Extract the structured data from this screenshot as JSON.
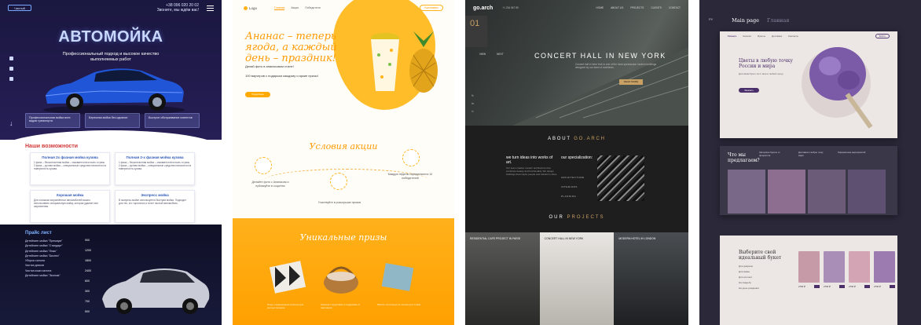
{
  "carwash": {
    "phone": "+38 096 020 20 02",
    "phone_sub": "Звоните, мы ждём вас!",
    "logo": "Чистый",
    "title": "АВТОМОЙКА",
    "subtitle": "Профессиональный подход и высокое качество выполняемых работ",
    "features": [
      "Профессиональная мойка всех видов транспорта",
      "Бережная мойка без царапин",
      "Быстрое обслуживание клиентов"
    ],
    "section_title": "Наши возможности",
    "services": [
      {
        "title": "Полная 2х фазная мойка кузова",
        "text": "1 фаза – бесконтактная мойка – смывается вся пыль и грязь. 2 фаза – ручная мойка – специальные средства наносятся на поверхность кузова."
      },
      {
        "title": "Полная 2-х фазная мойка кузова",
        "text": "1 фаза – бесконтактная мойка – смывается вся пыль и грязь. 2 фаза – ручная мойка – специальные средства наносятся на поверхность кузова."
      },
      {
        "title": "Хорошая мойка",
        "text": "Для слишком загрязнённых автомобилей можно использовать специальную мойку, которая удаляет все загрязнения."
      },
      {
        "title": "Экспресс мойка",
        "text": "В экспресс-мойке используется быстрая мойка. Подходит для тех, кто торопится и хочет чистый автомобиль."
      }
    ],
    "price_title": "Прайс лист",
    "prices": [
      "Детейлинг мойка \"Премиум\"",
      "Детейлинг мойка \"Стандарт\"",
      "Детейлинг мойка \"Люкс\"",
      "Детейлинг мойка \"Бизнес\"",
      "Уборка салона",
      "Чистка дисков",
      "Чистка кожи салона",
      "Детейлинг мойка \"Эконом\""
    ],
    "price_values": [
      "900",
      "1200",
      "1800",
      "2400",
      "600",
      "300",
      "700",
      "500"
    ]
  },
  "pineapple": {
    "logo": "Logo",
    "nav": [
      "Главная",
      "Акция",
      "Победители"
    ],
    "top_button": "Участвовать",
    "headline": "Ананас – теперь ягода, а каждый день – праздник!",
    "sub1": "Делай фото в ананасовом стиле!",
    "sub2": "100 ваучеров с подарком каждому и яркие призы!",
    "cta": "Подробнее",
    "conditions_title": "Условия акции",
    "steps": [
      "Делайте фото с Ананасом и публикуйте в соцсетях",
      "Участвуйте в розыгрыше призов",
      "Каждую неделю определяются 10 победителей"
    ],
    "prizes_title": "Уникальные призы",
    "prize_texts": [
      "Плед с ананасовым принтом для уютных вечеров",
      "Корзина с фруктами и подарками от партнёров",
      "Мягкое полотенце из хлопка для пляжа"
    ]
  },
  "arch": {
    "logo": "go.arch",
    "contact": "+1 234 567 89",
    "nav": [
      "HOME",
      "ABOUT US",
      "PROJECTS",
      "CLIENTS",
      "CONTACT"
    ],
    "number": "01",
    "tabs": [
      "VIEW",
      "NEXT"
    ],
    "hero_title": "CONCERT HALL IN NEW YORK",
    "hero_desc": "Concert hall in New York is one of the most spectacular modern buildings designed by our team of architects.",
    "hero_button": "READ MORE",
    "side": [
      "fb",
      "tw",
      "in"
    ],
    "about_title": "ABOUT",
    "about_accent": "GO.ARCH",
    "about_lead": "we turn ideas into works of art.",
    "about_text": "Our team creates modern architecture that combines beauty and functionality. We design buildings that inspire people and transform cities.",
    "spec_title": "our specialization:",
    "spec_list": [
      "ARCHITECTURE",
      "INTERIORS",
      "PLANNING"
    ],
    "projects_title": "OUR",
    "projects_accent": "PROJECTS",
    "projects": [
      "RESIDENTIAL CAFE PROJECT IN PARIS",
      "CONCERT HALL IN NEW YORK",
      "MODERN HOTEL IN LONDON"
    ]
  },
  "flowers": {
    "lang": "РУ",
    "tab_main": "Main page",
    "tab_other": "Главная",
    "hero_logo": "Flowers",
    "hero_nav": [
      "Каталог",
      "Букеты",
      "Доставка",
      "Контакты"
    ],
    "hero_button_top": "Войти",
    "hero_title": "Цветы в любую точку России и мира",
    "hero_sub": "Доставим букет за 2 часа в любой город",
    "hero_button": "Заказать",
    "offer_title": "Что мы предлагаем?",
    "offer_cols": [
      "Авторские букеты от флористов",
      "Доставка в любую точку мира",
      "Оформление мероприятий"
    ],
    "choose_title": "Выберите свой идеальный букет",
    "choose_list": [
      "Для девушки",
      "Для мамы",
      "Для коллеги",
      "На свадьбу",
      "На день рождения"
    ],
    "product_prices": [
      "2700 ₽",
      "2700 ₽",
      "2700 ₽",
      "2700 ₽"
    ],
    "colors": {
      "accent": "#4a2f6a",
      "bg": "#2b2839"
    }
  }
}
